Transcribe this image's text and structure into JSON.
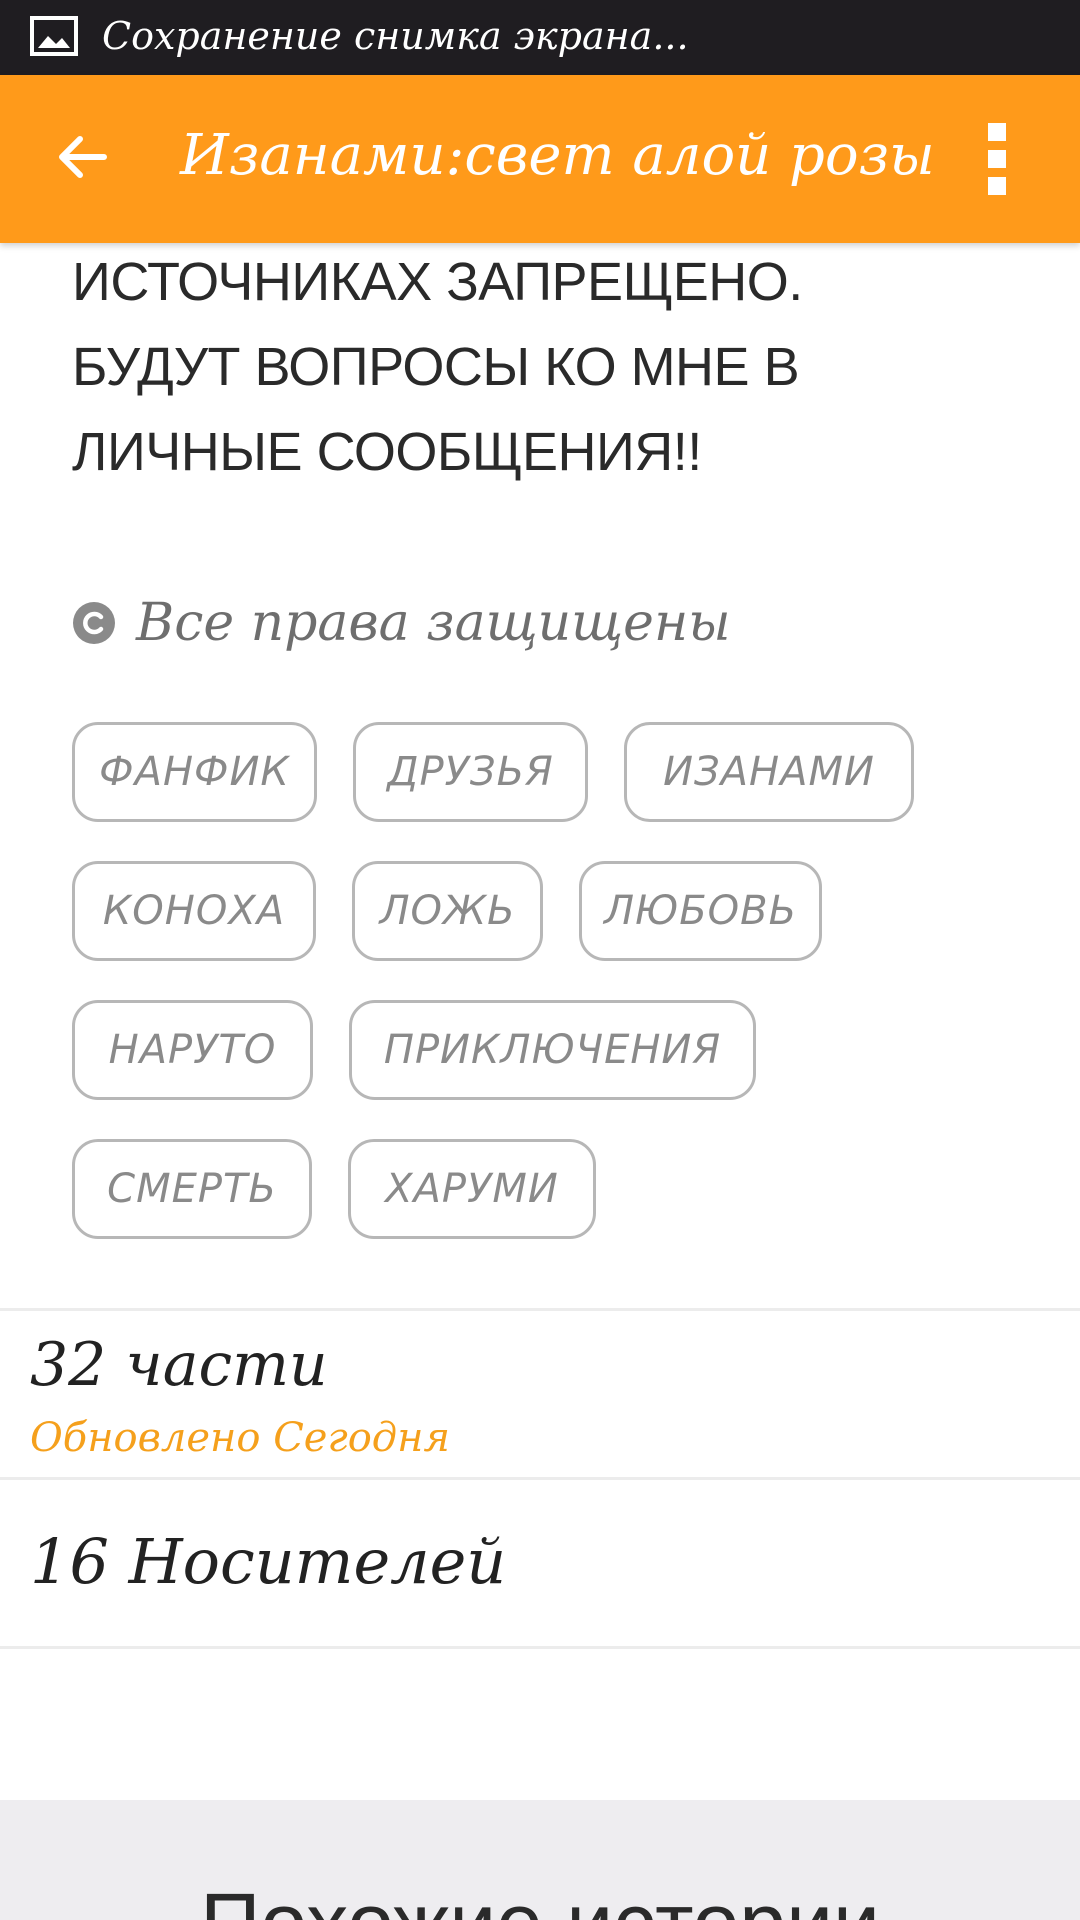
{
  "status_bar": {
    "notification_text": "Сохранение снимка экрана...",
    "icon": "image-icon"
  },
  "app_bar": {
    "title": "Изанами:свет алой розы",
    "back_icon": "arrow-left-icon",
    "menu_icon": "more-vertical-icon",
    "color": "#ff9a1a"
  },
  "description": {
    "lines": [
      "ИСТОЧНИКАХ ЗАПРЕЩЕНО.",
      "БУДУТ ВОПРОСЫ КО МНЕ В",
      "ЛИЧНЫЕ СООБЩЕНИЯ!!"
    ]
  },
  "copyright": {
    "icon": "copyright-icon",
    "text": "Все права защищены"
  },
  "tags": [
    "ФАНФИК",
    "ДРУЗЬЯ",
    "ИЗАНАМИ",
    "КОНОХА",
    "ЛОЖЬ",
    "ЛЮБОВЬ",
    "НАРУТО",
    "ПРИКЛЮЧЕНИЯ",
    "СМЕРТЬ",
    "ХАРУМИ"
  ],
  "parts": {
    "count_label": "32 части",
    "updated_label": "Обновлено Сегодня",
    "accent": "#f5a01c"
  },
  "carriers": {
    "label": "16 Носителей"
  },
  "similar": {
    "title": "Похожие истории"
  }
}
